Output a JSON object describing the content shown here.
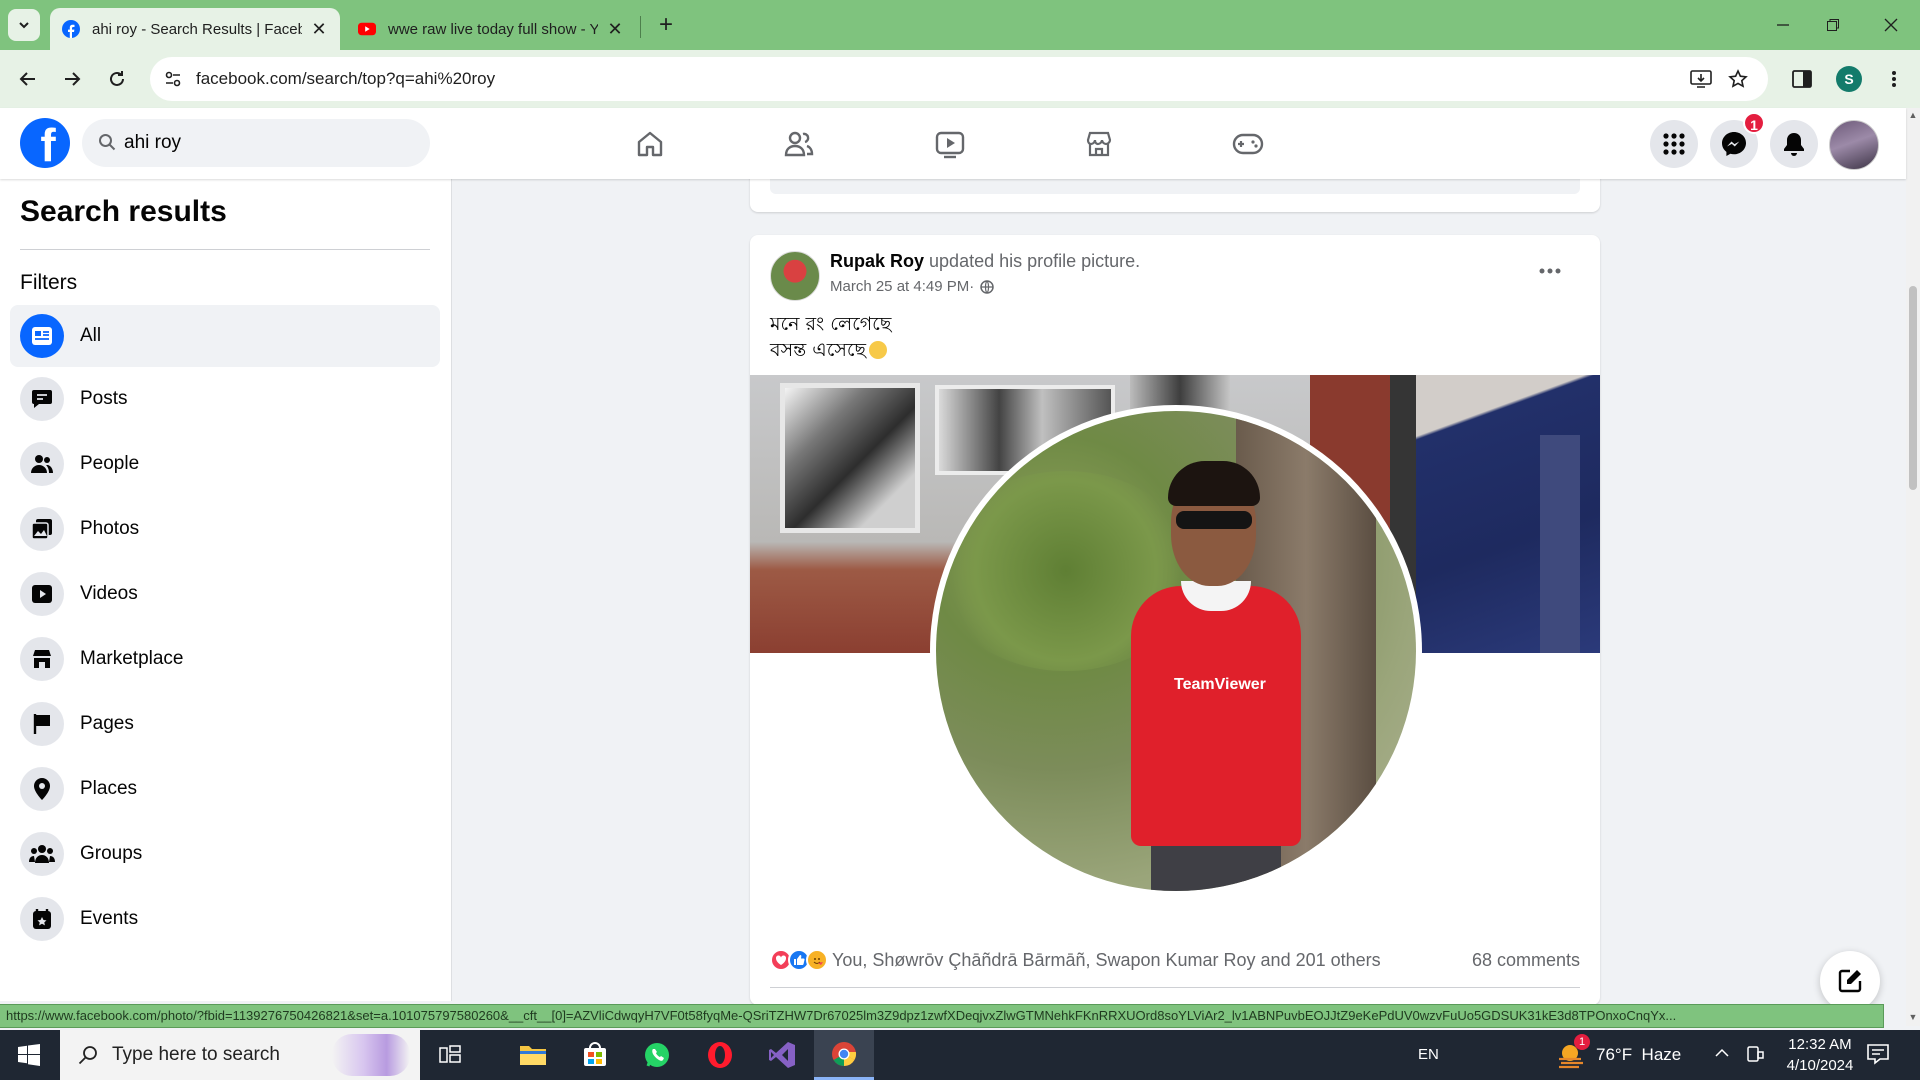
{
  "browser": {
    "tabs": [
      {
        "title": "ahi roy - Search Results | Faceb",
        "active": true,
        "icon": "facebook-icon"
      },
      {
        "title": "wwe raw live today full show - Y",
        "active": false,
        "icon": "youtube-icon"
      }
    ],
    "url": "facebook.com/search/top?q=ahi%20roy",
    "profile_initial": "S",
    "accent": "#7fc37e"
  },
  "fb_header": {
    "logo_letter": "f",
    "search_value": "ahi roy",
    "messenger_badge": "1",
    "nav": [
      "home-icon",
      "friends-icon",
      "watch-icon",
      "marketplace-icon",
      "gaming-icon"
    ]
  },
  "sidebar": {
    "title": "Search results",
    "filters_label": "Filters",
    "filters": [
      {
        "label": "All",
        "icon": "feed-icon",
        "active": true
      },
      {
        "label": "Posts",
        "icon": "posts-icon"
      },
      {
        "label": "People",
        "icon": "people-icon"
      },
      {
        "label": "Photos",
        "icon": "photos-icon"
      },
      {
        "label": "Videos",
        "icon": "videos-icon"
      },
      {
        "label": "Marketplace",
        "icon": "marketplace-icon"
      },
      {
        "label": "Pages",
        "icon": "flag-icon"
      },
      {
        "label": "Places",
        "icon": "pin-icon"
      },
      {
        "label": "Groups",
        "icon": "groups-icon"
      },
      {
        "label": "Events",
        "icon": "calendar-icon"
      }
    ]
  },
  "post": {
    "author": "Rupak Roy",
    "action": " updated his profile picture.",
    "timestamp": "March 25 at 4:49 PM",
    "separator": " · ",
    "text_line1": "মনে রং লেগেছে",
    "text_line2": "বসন্ত এসেছে",
    "jersey_text": "TeamViewer",
    "reactions_text": "You, Shøwrōv Çhāñdrā Bārmāñ, Swapon Kumar Roy and 201 others",
    "comments": "68 comments"
  },
  "status_url": "https://www.facebook.com/photo/?fbid=1139276750426821&set=a.101075797580260&__cft__[0]=AZVliCdwqyH7VF0t58fyqMe-QSriTZHW7Dr67025lm3Z9dpz1zwfXDeqjvxZlwGTMNehkFKnRRXUOrd8soYLViAr2_lv1ABNPuvbEOJJtZ9eKePdUV0wzvFuUo5GDSUK31kE3d8TPOnxoCnqYx...",
  "taskbar": {
    "search_placeholder": "Type here to search",
    "language": "EN",
    "weather": "76°F  Haze",
    "weather_badge": "1",
    "time": "12:32 AM",
    "date": "4/10/2024"
  }
}
